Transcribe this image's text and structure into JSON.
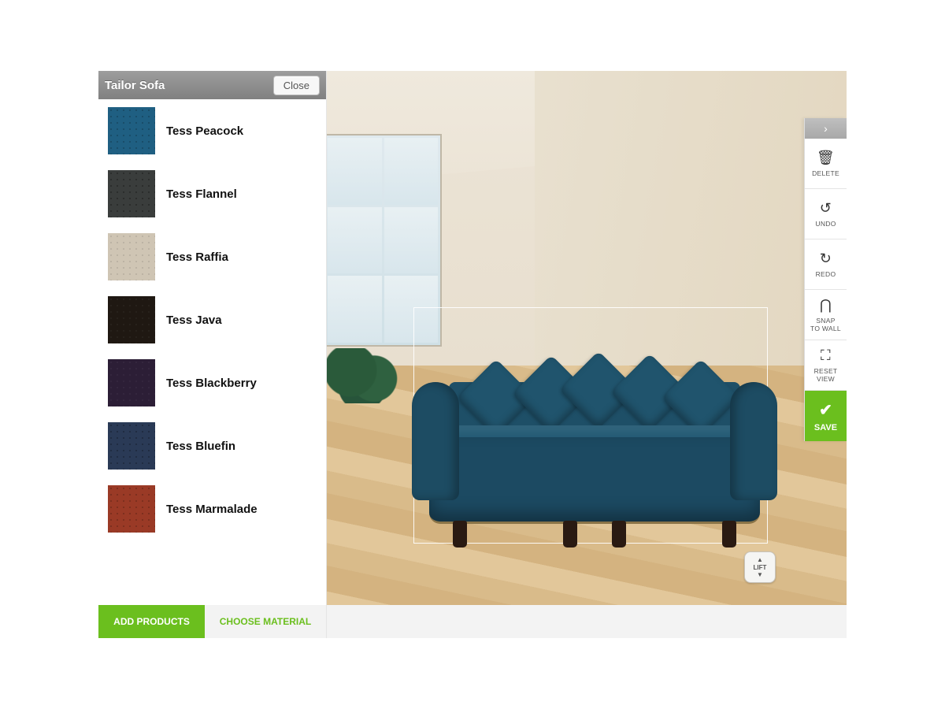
{
  "panel": {
    "title": "Tailor Sofa",
    "close_label": "Close",
    "swatches": [
      {
        "name": "Tess Peacock",
        "tex": "tex-peacock"
      },
      {
        "name": "Tess Flannel",
        "tex": "tex-flannel"
      },
      {
        "name": "Tess Raffia",
        "tex": "tex-raffia"
      },
      {
        "name": "Tess Java",
        "tex": "tex-java"
      },
      {
        "name": "Tess Blackberry",
        "tex": "tex-blackberry"
      },
      {
        "name": "Tess Bluefin",
        "tex": "tex-bluefin"
      },
      {
        "name": "Tess Marmalade",
        "tex": "tex-marmalade"
      }
    ],
    "add_products_label": "ADD PRODUCTS",
    "choose_material_label": "CHOOSE MATERIAL"
  },
  "scene": {
    "lift_label": "LIFT"
  },
  "toolbar": {
    "delete_label": "DELETE",
    "undo_label": "UNDO",
    "redo_label": "REDO",
    "snap_label": "SNAP\nTO WALL",
    "reset_label": "RESET\nVIEW",
    "save_label": "SAVE"
  },
  "colors": {
    "accent_green": "#6bbf1e",
    "sofa_primary": "#1f5f82"
  }
}
